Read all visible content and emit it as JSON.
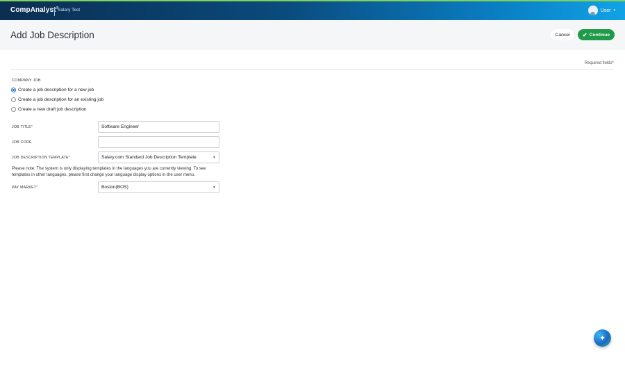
{
  "app": {
    "brand": "CompAnalyst",
    "brand_mark": "®",
    "subtitle": "Salary Test",
    "user_label": "User",
    "user_caret": "▾"
  },
  "header": {
    "title": "Add Job Description",
    "cancel_label": "Cancel",
    "continue_label": "Continue",
    "continue_icon": "✔"
  },
  "form": {
    "required_text": "Required fields",
    "required_star": "*",
    "section_label": "COMPANY JOB",
    "radio_options": [
      {
        "label": "Create a job description for a new job",
        "checked": true
      },
      {
        "label": "Create a job description for an existing job",
        "checked": false
      },
      {
        "label": "Create a new draft job description",
        "checked": false
      }
    ],
    "job_title": {
      "label": "JOB TITLE",
      "star": "*",
      "value": "Software Engineer"
    },
    "job_code": {
      "label": "JOB CODE",
      "value": ""
    },
    "template": {
      "label": "JOB DESCRIPTION TEMPLATE",
      "star": "*",
      "value": "Salary.com Standard Job Description Template"
    },
    "note": "Please note: The system is only displaying templates in the languages you are currently viewing. To see templates in other languages, please first change your language display options in the user menu.",
    "pay_market": {
      "label": "PAY MARKET",
      "star": "*",
      "value": "Boston(BOS)"
    }
  },
  "colors": {
    "accent_green": "#1f9a48",
    "radio_blue": "#1f6bb8",
    "topbar_dark": "#0b2e52",
    "topbar_light": "#12a2e6"
  },
  "icons": {
    "continue": "check-icon",
    "select_arrow": "chevron-down-icon",
    "fab": "sparkle-icon",
    "user": "user-avatar-icon"
  }
}
